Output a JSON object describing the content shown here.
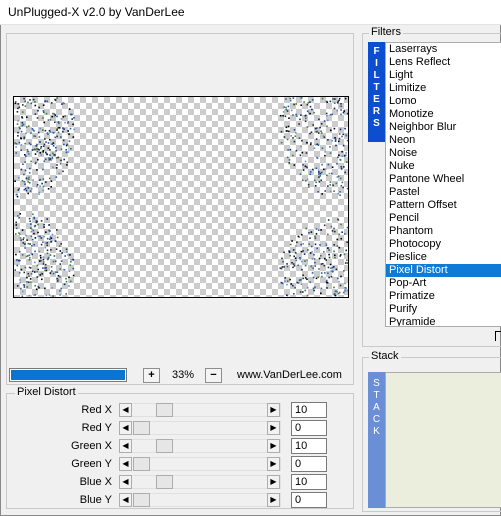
{
  "window": {
    "title": "UnPlugged-X v2.0 by VanDerLee"
  },
  "zoom": {
    "progress": 1.0,
    "plus_label": "+",
    "minus_label": "−",
    "value": "33%",
    "site": "www.VanDerLee.com"
  },
  "params": {
    "group_title": "Pixel Distort",
    "rows": [
      {
        "label": "Red X",
        "value": "10",
        "slider_fraction": 0.2
      },
      {
        "label": "Red Y",
        "value": "0",
        "slider_fraction": 0.0
      },
      {
        "label": "Green X",
        "value": "10",
        "slider_fraction": 0.2
      },
      {
        "label": "Green Y",
        "value": "0",
        "slider_fraction": 0.0
      },
      {
        "label": "Blue X",
        "value": "10",
        "slider_fraction": 0.2
      },
      {
        "label": "Blue Y",
        "value": "0",
        "slider_fraction": 0.0
      }
    ],
    "arrow_left": "◀",
    "arrow_right": "▶"
  },
  "filters": {
    "group_title": "Filters",
    "strip_letters": [
      "F",
      "I",
      "L",
      "T",
      "E",
      "R",
      "S"
    ],
    "items": [
      "Laserrays",
      "Lens Reflect",
      "Light",
      "Limitize",
      "Lomo",
      "Monotize",
      "Neighbor Blur",
      "Neon",
      "Noise",
      "Nuke",
      "Pantone Wheel",
      "Pastel",
      "Pattern Offset",
      "Pencil",
      "Phantom",
      "Photocopy",
      "Pieslice",
      "Pixel Distort",
      "Pop-Art",
      "Primatize",
      "Purify",
      "Pyramide"
    ],
    "selected": "Pixel Distort"
  },
  "stack": {
    "group_title": "Stack",
    "strip_letters": [
      "S",
      "T",
      "A",
      "C",
      "K"
    ]
  }
}
